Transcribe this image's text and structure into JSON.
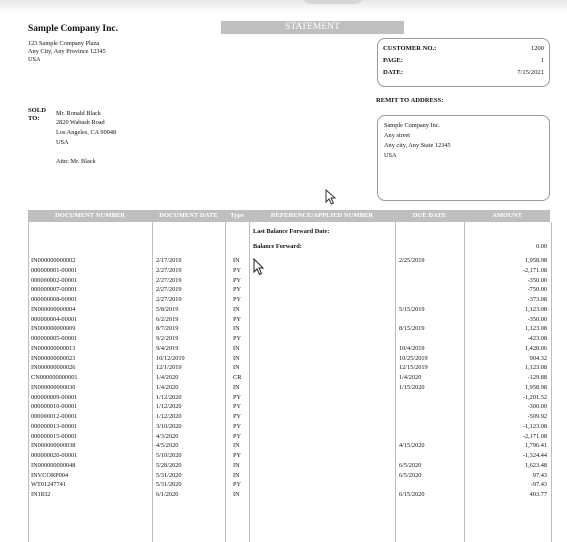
{
  "company": {
    "name": "Sample Company Inc.",
    "address_lines": [
      "123 Sample Company Plaza",
      "Any City, Any Province 12345",
      "USA"
    ]
  },
  "statement_title": "STATEMENT",
  "info": {
    "customer_no_label": "CUSTOMER NO.:",
    "customer_no": "1200",
    "page_label": "PAGE:",
    "page": "1",
    "date_label": "DATE:",
    "date": "7/15/2021"
  },
  "remit": {
    "label": "REMIT TO ADDRESS:",
    "lines": [
      "Sample Company Inc.",
      "Any street",
      "Any city, Any State 12345",
      "USA"
    ]
  },
  "sold_to": {
    "label_line1": "SOLD",
    "label_line2": "TO:",
    "lines": [
      "Mr. Ronald Black",
      "2820 Wabash Road",
      "Los Angeles, CA 90048",
      "USA"
    ],
    "attn": "Attn: Mr. Black"
  },
  "table": {
    "headers": [
      "DOCUMENT NUMBER",
      "DOCUMENT DATE",
      "Type",
      "REFERENCE/APPLIED NUMBER",
      "DUE DATE",
      "AMOUNT"
    ],
    "last_balance_forward_label": "Last Balance Forward Date:",
    "balance_forward_label": "Balance Forward:",
    "balance_forward_amount": "0.00",
    "rows": [
      {
        "doc": "IN000000000002",
        "date": "2/17/2019",
        "type": "IN",
        "due": "2/25/2019",
        "amount": "1,958.98"
      },
      {
        "doc": "000000001-00001",
        "date": "2/27/2019",
        "type": "PY",
        "due": "",
        "amount": "-2,171.08"
      },
      {
        "doc": "000000002-00001",
        "date": "2/27/2019",
        "type": "PY",
        "due": "",
        "amount": "-350.00"
      },
      {
        "doc": "000000007-00001",
        "date": "2/27/2019",
        "type": "PY",
        "due": "",
        "amount": "-750.00"
      },
      {
        "doc": "000000008-00001",
        "date": "2/27/2019",
        "type": "PY",
        "due": "",
        "amount": "-373.08"
      },
      {
        "doc": "IN000000000004",
        "date": "5/8/2019",
        "type": "IN",
        "due": "5/15/2019",
        "amount": "1,123.08"
      },
      {
        "doc": "000000004-00001",
        "date": "6/2/2019",
        "type": "PY",
        "due": "",
        "amount": "-350.00"
      },
      {
        "doc": "IN000000000009",
        "date": "8/7/2019",
        "type": "IN",
        "due": "8/15/2019",
        "amount": "1,123.08"
      },
      {
        "doc": "000000005-00001",
        "date": "9/2/2019",
        "type": "PY",
        "due": "",
        "amount": "-423.08"
      },
      {
        "doc": "IN000000000013",
        "date": "9/4/2019",
        "type": "IN",
        "due": "10/4/2019",
        "amount": "1,428.06"
      },
      {
        "doc": "IN000000000023",
        "date": "10/12/2019",
        "type": "IN",
        "due": "10/25/2019",
        "amount": "904.32"
      },
      {
        "doc": "IN000000000026",
        "date": "12/1/2019",
        "type": "IN",
        "due": "12/15/2019",
        "amount": "1,123.08"
      },
      {
        "doc": "CN000000000001",
        "date": "1/4/2020",
        "type": "CR",
        "due": "1/4/2020",
        "amount": "-129.88"
      },
      {
        "doc": "IN000000000030",
        "date": "1/4/2020",
        "type": "IN",
        "due": "1/15/2020",
        "amount": "1,958.98"
      },
      {
        "doc": "000000009-00001",
        "date": "1/12/2020",
        "type": "PY",
        "due": "",
        "amount": "-1,201.52"
      },
      {
        "doc": "000000010-00001",
        "date": "1/12/2020",
        "type": "PY",
        "due": "",
        "amount": "-300.00"
      },
      {
        "doc": "000000012-00001",
        "date": "1/12/2020",
        "type": "PY",
        "due": "",
        "amount": "-509.92"
      },
      {
        "doc": "000000013-00001",
        "date": "3/10/2020",
        "type": "PY",
        "due": "",
        "amount": "-1,123.08"
      },
      {
        "doc": "000000015-00001",
        "date": "4/3/2020",
        "type": "PY",
        "due": "",
        "amount": "-2,171.08"
      },
      {
        "doc": "IN000000000038",
        "date": "4/5/2020",
        "type": "IN",
        "due": "4/15/2020",
        "amount": "1,796.41"
      },
      {
        "doc": "000000020-00001",
        "date": "5/10/2020",
        "type": "PY",
        "due": "",
        "amount": "-1,324.44"
      },
      {
        "doc": "IN000000000048",
        "date": "5/28/2020",
        "type": "IN",
        "due": "6/5/2020",
        "amount": "1,623.48"
      },
      {
        "doc": "INVCORP004",
        "date": "5/31/2020",
        "type": "IN",
        "due": "6/5/2020",
        "amount": "97.43"
      },
      {
        "doc": "WT01247741",
        "date": "5/31/2020",
        "type": "PY",
        "due": "",
        "amount": "-97.43"
      },
      {
        "doc": "IN1832",
        "date": "6/1/2020",
        "type": "IN",
        "due": "6/15/2020",
        "amount": "403.77"
      }
    ]
  }
}
